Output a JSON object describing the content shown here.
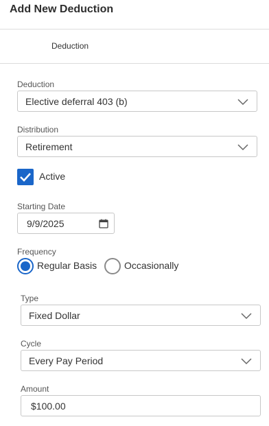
{
  "header": {
    "title": "Add New Deduction"
  },
  "tabs": [
    {
      "label": "Deduction"
    }
  ],
  "form": {
    "deduction": {
      "label": "Deduction",
      "value": "Elective deferral 403 (b)"
    },
    "distribution": {
      "label": "Distribution",
      "value": "Retirement"
    },
    "active": {
      "label": "Active",
      "checked": true
    },
    "starting_date": {
      "label": "Starting Date",
      "value": "9/9/2025"
    },
    "frequency": {
      "label": "Frequency",
      "options": [
        {
          "label": "Regular Basis",
          "selected": true
        },
        {
          "label": "Occasionally",
          "selected": false
        }
      ]
    },
    "type": {
      "label": "Type",
      "value": "Fixed Dollar"
    },
    "cycle": {
      "label": "Cycle",
      "value": "Every Pay Period"
    },
    "amount": {
      "label": "Amount",
      "value": "$100.00"
    }
  },
  "colors": {
    "accent": "#1a66c9",
    "border": "#c7c7c7",
    "divider": "#dcdcdc"
  },
  "icons": {
    "select_arrow": "chevron-down-icon",
    "date_picker": "calendar-icon",
    "checkbox_mark": "checkmark-icon"
  }
}
